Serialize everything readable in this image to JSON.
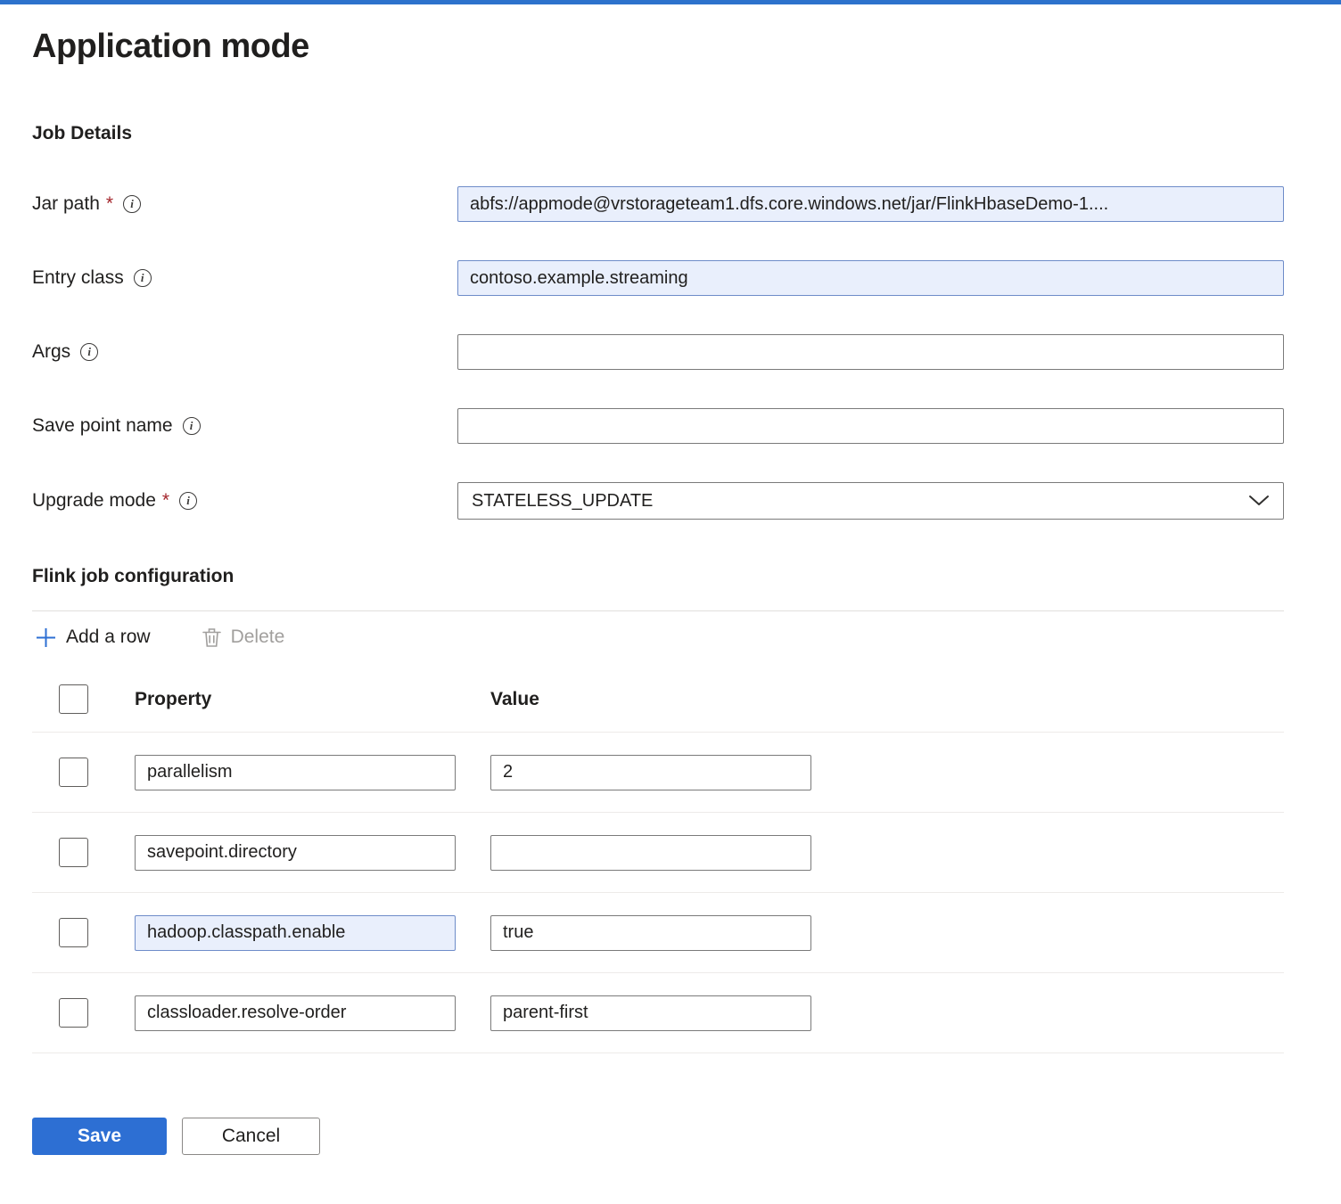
{
  "page": {
    "title": "Application mode"
  },
  "required_marker": "*",
  "colors": {
    "accent": "#2d6fd3",
    "top_bar": "#2d72cc",
    "filled_input_bg": "#e9effc",
    "required_asterisk": "#a4262c"
  },
  "icons": {
    "info": "circle-i",
    "add_row": "plus",
    "delete": "trash",
    "upgrade_mode": "chevron-down"
  },
  "job_details": {
    "heading": "Job Details",
    "fields": [
      {
        "label": "Jar path",
        "required": true,
        "value": "abfs://appmode@vrstorageteam1.dfs.core.windows.net/jar/FlinkHbaseDemo-1....",
        "filled": true
      },
      {
        "label": "Entry class",
        "required": false,
        "value": "contoso.example.streaming",
        "filled": true
      },
      {
        "label": "Args",
        "required": false,
        "value": "",
        "filled": false
      },
      {
        "label": "Save point name",
        "required": false,
        "value": "",
        "filled": false
      },
      {
        "label": "Upgrade mode",
        "required": true,
        "value": "STATELESS_UPDATE",
        "control": "dropdown"
      }
    ]
  },
  "flink_job_configuration": {
    "heading": "Flink job configuration",
    "toolbar": {
      "add_row_label": "Add a row",
      "delete_label": "Delete"
    },
    "table": {
      "headers": {
        "property": "Property",
        "value": "Value"
      },
      "rows": [
        {
          "property": "parallelism",
          "value": "2",
          "property_filled": false
        },
        {
          "property": "savepoint.directory",
          "value": "",
          "property_filled": false
        },
        {
          "property": "hadoop.classpath.enable",
          "value": "true",
          "property_filled": true
        },
        {
          "property": "classloader.resolve-order",
          "value": "parent-first",
          "property_filled": false
        }
      ]
    }
  },
  "footer": {
    "save_label": "Save",
    "cancel_label": "Cancel"
  }
}
